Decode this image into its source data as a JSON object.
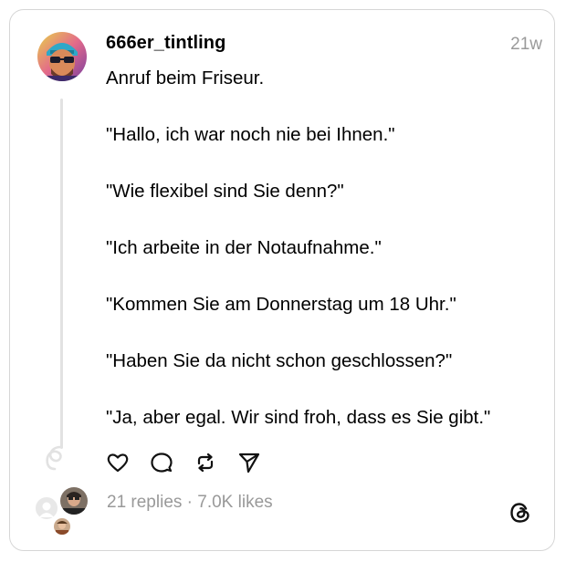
{
  "post": {
    "username": "666er_tintling",
    "timestamp": "21w",
    "lines": [
      "Anruf beim Friseur.",
      "",
      "\"Hallo, ich war noch nie bei Ihnen.\"",
      "",
      "\"Wie flexibel sind Sie denn?\"",
      "",
      "\"Ich arbeite in der Notaufnahme.\"",
      "",
      "\"Kommen Sie am Donnerstag um 18 Uhr.\"",
      "",
      "\"Haben Sie da nicht schon geschlossen?\"",
      "",
      "\"Ja, aber egal. Wir sind froh, dass es Sie gibt.\""
    ]
  },
  "actions": {
    "like_icon": "heart-icon",
    "reply_icon": "comment-icon",
    "repost_icon": "repost-icon",
    "share_icon": "send-icon"
  },
  "stats": {
    "text": "21 replies · 7.0K likes"
  },
  "brand": {
    "logo": "threads-logo-icon"
  },
  "colors": {
    "border": "#d6d6d6",
    "muted": "#999999",
    "thread_line": "#e2e2e2"
  }
}
